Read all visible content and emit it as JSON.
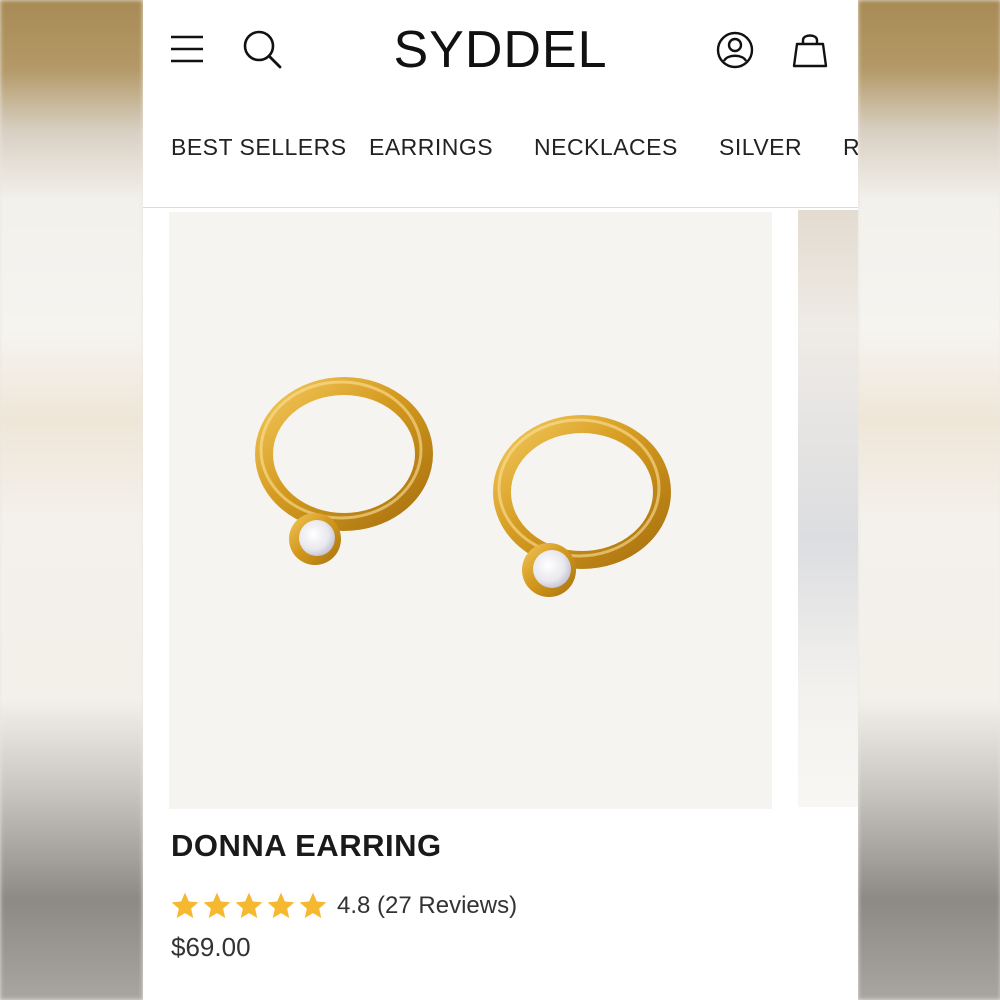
{
  "header": {
    "logo_text": "SYDDEL",
    "icons": [
      "menu-icon",
      "search-icon",
      "account-icon",
      "bag-icon"
    ]
  },
  "nav": {
    "items": [
      "BEST SELLERS",
      "EARRINGS",
      "NECKLACES",
      "SILVER",
      "R"
    ]
  },
  "product": {
    "title": "DONNA EARRING",
    "rating": 4.8,
    "stars_filled": 5,
    "rating_text": "4.8 (27 Reviews)",
    "price": "$69.00",
    "image_description_icon": "gold-hoop-earrings-image"
  },
  "colors": {
    "star": "#f5b82e",
    "gold": "#d4a02a",
    "text": "#1a1a1a"
  }
}
